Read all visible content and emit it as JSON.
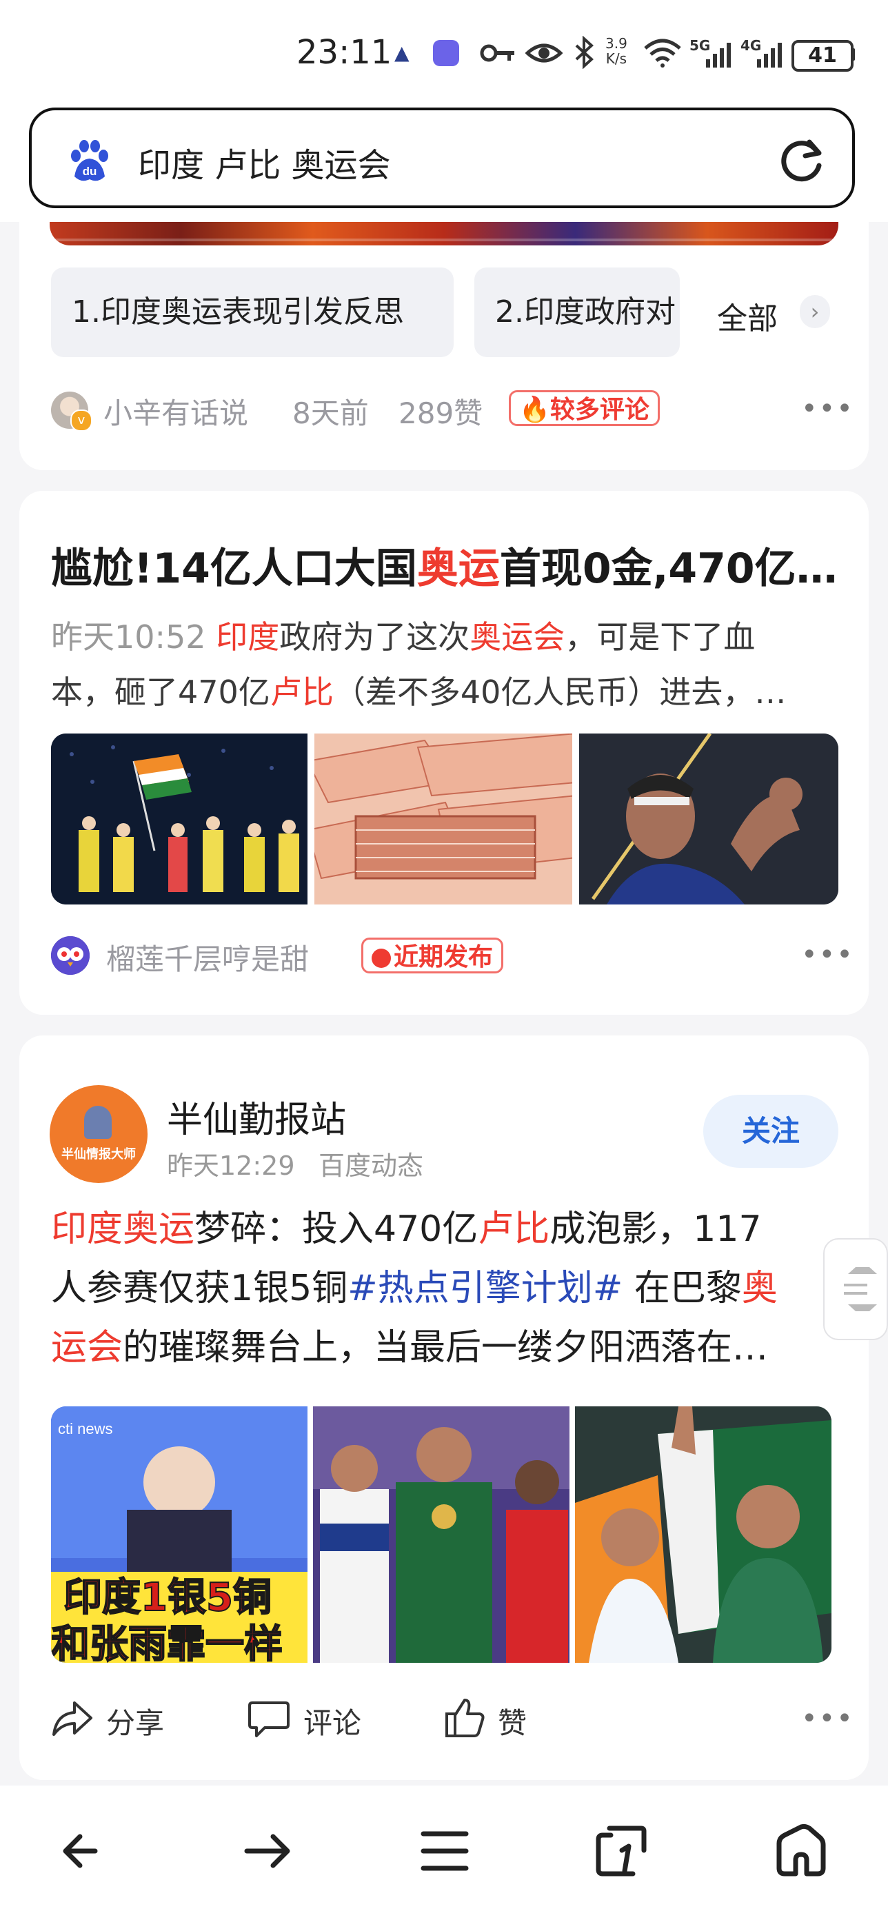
{
  "status_bar": {
    "time": "23:11",
    "speed_top": "3.9",
    "speed_bottom": "K/s",
    "net_5g": "5G",
    "net_4g": "4G",
    "battery": "41",
    "icons": [
      "cat-app-icon",
      "baidu-app-icon",
      "key-icon",
      "eye-icon",
      "bluetooth-icon",
      "wifi-icon",
      "signal-5g-icon",
      "signal-4g-icon",
      "battery-icon"
    ]
  },
  "search": {
    "query": "印度 卢比 奥运会",
    "logo_text": "du"
  },
  "card1": {
    "chips": [
      "1.印度奥运表现引发反思",
      "2.印度政府对"
    ],
    "all_label": "全部",
    "author": "小辛有话说",
    "time": "8天前",
    "likes": "289赞",
    "badge": "较多评论"
  },
  "card2": {
    "title_parts": [
      "尴尬!14亿人口大国",
      "奥运",
      "首现0金,470亿…"
    ],
    "date": "昨天10:52",
    "snippet_line1": [
      " ",
      "印度",
      "政府为了这次",
      "奥运会",
      "，可是下了血"
    ],
    "snippet_line2": [
      "本，砸了470亿",
      "卢比",
      "（差不多40亿人民币）进去，…"
    ],
    "author": "榴莲千层哼是甜",
    "badge": "近期发布"
  },
  "card3": {
    "account": "半仙勤报站",
    "avatar_text": "半仙情报大师",
    "date": "昨天12:29",
    "source": "百度动态",
    "follow_label": "关注",
    "line1": [
      "印度奥运",
      "梦碎：投入470亿",
      "卢比",
      "成泡影，117"
    ],
    "line2": [
      "人参赛仅获1银5铜",
      "#热点引擎计划#",
      " 在巴黎",
      "奥"
    ],
    "line3": [
      "运会",
      "的璀璨舞台上，当最后一缕夕阳洒落在…"
    ],
    "image1_caption_1": "印度1银5铜",
    "image1_caption_2": "和张雨霏一样",
    "image1_logo": "cti news",
    "share_label": "分享",
    "comment_label": "评论",
    "like_label": "赞"
  },
  "colors": {
    "keyword_red": "#ee3b2f",
    "hashtag_blue": "#2a4ab8",
    "follow_blue": "#2566d8"
  }
}
